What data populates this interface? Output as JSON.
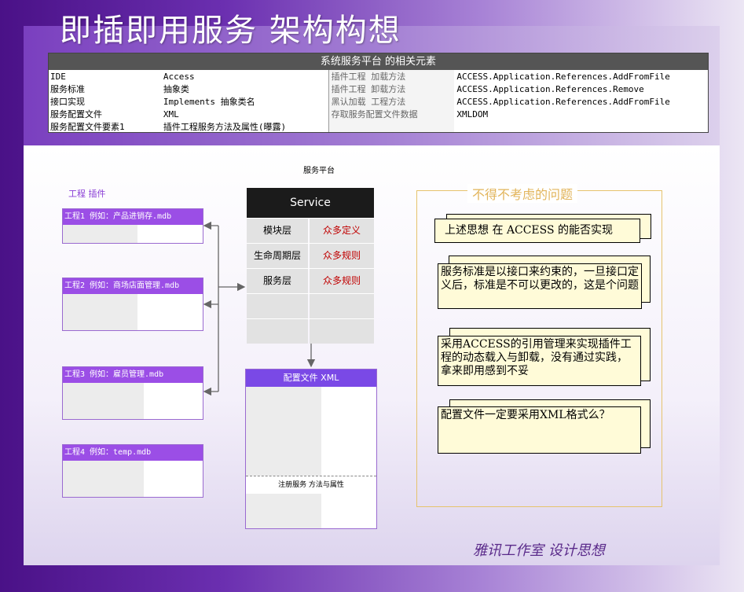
{
  "title": "即插即用服务  架构构想",
  "table": {
    "header": "系统服务平台 的相关元素",
    "col1": [
      "IDE",
      "服务标准",
      "接口实现",
      "服务配置文件",
      "服务配置文件要素1"
    ],
    "col2": [
      "Access",
      "抽象类",
      "Implements 抽象类名",
      "XML",
      "插件工程服务方法及属性(曝露)"
    ],
    "col3": [
      "插件工程 加载方法",
      "插件工程 卸载方法",
      "黑认加载 工程方法",
      "存取服务配置文件数据"
    ],
    "col4": [
      "ACCESS.Application.References.AddFromFile",
      "ACCESS.Application.References.Remove",
      "ACCESS.Application.References.AddFromFile",
      "XMLDOM"
    ]
  },
  "platform_label": "服务平台",
  "plugins_label": "工程  插件",
  "projects": [
    {
      "label": "工程1  例如：产品进销存.mdb"
    },
    {
      "label": "工程2  例如：商场店面管理.mdb"
    },
    {
      "label": "工程3  例如：雇员管理.mdb"
    },
    {
      "label": "工程4  例如：temp.mdb"
    }
  ],
  "service": {
    "header": "Service",
    "rows": [
      {
        "name": "模块层",
        "value": "众多定义"
      },
      {
        "name": "生命周期层",
        "value": "众多规则"
      },
      {
        "name": "服务层",
        "value": "众多规则"
      },
      {
        "name": "",
        "value": ""
      },
      {
        "name": "",
        "value": ""
      }
    ]
  },
  "config": {
    "header": "配置文件   XML",
    "mid_label": "注册服务  方法与属性"
  },
  "issues": {
    "title": "不得不考虑的问题",
    "notes": [
      "上述思想 在 ACCESS 的能否实现",
      "服务标准是以接口来约束的，一旦接口定义后，标准是不可以更改的，这是个问题",
      "采用ACCESS的引用管理来实现插件工程的动态载入与卸载，没有通过实践，拿来即用感到不妥",
      "配置文件一定要采用XML格式么？"
    ]
  },
  "footer": "雅讯工作室  设计思想",
  "colors": {
    "accent": "#9b4ee6",
    "header_dark": "#1b1b1b",
    "red_text": "#c00000",
    "note_bg": "#fffbd8"
  }
}
